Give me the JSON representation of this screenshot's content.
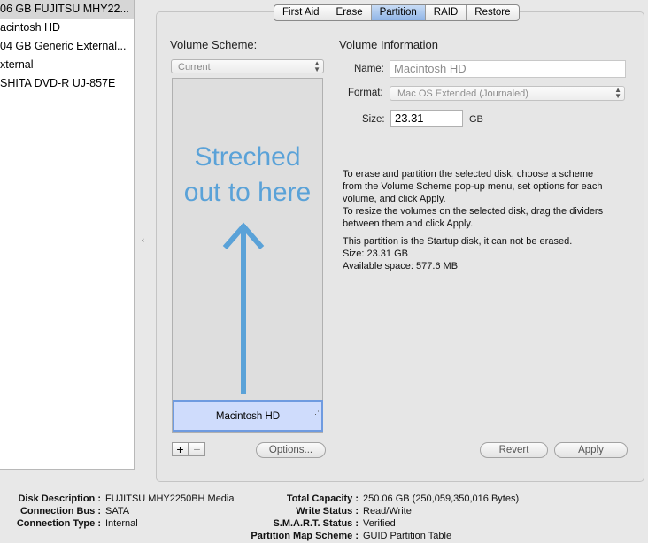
{
  "sidebar": {
    "items": [
      {
        "label": "06 GB FUJITSU MHY22..."
      },
      {
        "label": "acintosh HD"
      },
      {
        "label": "04 GB Generic External..."
      },
      {
        "label": "xternal"
      },
      {
        "label": "SHITA DVD-R UJ-857E"
      }
    ]
  },
  "tabs": [
    "First Aid",
    "Erase",
    "Partition",
    "RAID",
    "Restore"
  ],
  "active_tab": "Partition",
  "volume_scheme": {
    "label": "Volume Scheme:",
    "selected": "Current",
    "partition_name": "Macintosh HD",
    "annotation_line1": "Streched",
    "annotation_line2": "out to here",
    "add_symbol": "+",
    "remove_symbol": "−",
    "options_label": "Options..."
  },
  "volume_info": {
    "title": "Volume Information",
    "name_label": "Name:",
    "name_value": "Macintosh HD",
    "format_label": "Format:",
    "format_value": "Mac OS Extended (Journaled)",
    "size_label": "Size:",
    "size_value": "23.31",
    "size_unit": "GB"
  },
  "instructions": [
    "To erase and partition the selected disk, choose a scheme",
    "from the Volume Scheme pop-up menu, set options for each",
    "volume, and click Apply.",
    "To resize the volumes on the selected disk, drag the dividers",
    "between them and click Apply."
  ],
  "partition_notes": [
    "This partition is the Startup disk, it can not be erased.",
    "Size: 23.31 GB",
    "Available space: 577.6 MB"
  ],
  "buttons": {
    "revert": "Revert",
    "apply": "Apply"
  },
  "info_left": [
    {
      "label": "Disk Description :",
      "value": "FUJITSU MHY2250BH Media"
    },
    {
      "label": "Connection Bus :",
      "value": "SATA"
    },
    {
      "label": "Connection Type :",
      "value": "Internal"
    }
  ],
  "info_right": [
    {
      "label": "Total Capacity :",
      "value": "250.06 GB (250,059,350,016 Bytes)"
    },
    {
      "label": "Write Status :",
      "value": "Read/Write"
    },
    {
      "label": "S.M.A.R.T. Status :",
      "value": "Verified"
    },
    {
      "label": "Partition Map Scheme :",
      "value": "GUID Partition Table"
    }
  ],
  "colors": {
    "annotation": "#5aa2d8",
    "selected_tab": "#8fb4e6",
    "partition_fill": "#cfdcfc"
  }
}
